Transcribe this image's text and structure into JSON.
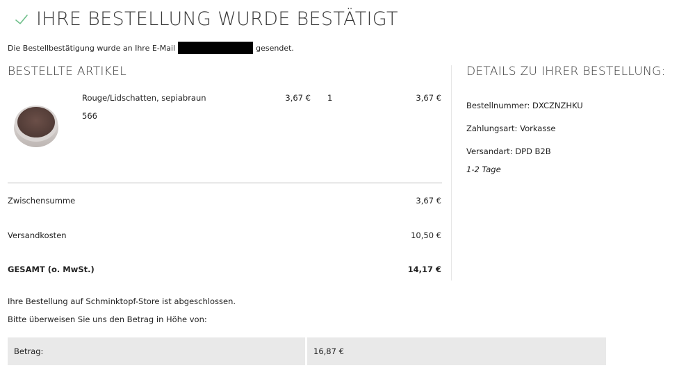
{
  "header": {
    "title": "IHRE BESTELLUNG WURDE BESTÄTIGT",
    "confirmation_prefix": "Die Bestellbestätigung wurde an Ihre E-Mail",
    "confirmation_suffix": "gesendet."
  },
  "ordered_items": {
    "title": "BESTELLTE ARTIKEL",
    "items": [
      {
        "name": "Rouge/Lidschatten, sepiabraun",
        "sku": "566",
        "unit_price": "3,67 €",
        "quantity": "1",
        "total": "3,67 €"
      }
    ]
  },
  "summary": {
    "subtotal_label": "Zwischensumme",
    "subtotal_value": "3,67 €",
    "shipping_label": "Versandkosten",
    "shipping_value": "10,50 €",
    "total_label": "GESAMT (o. MwSt.)",
    "total_value": "14,17 €"
  },
  "details": {
    "title": "DETAILS ZU IHRER BESTELLUNG:",
    "order_number": "Bestellnummer: DXCZNZHKU",
    "payment_method": "Zahlungsart: Vorkasse",
    "shipping_method": "Versandart: DPD B2B",
    "delivery_time": "1-2 Tage"
  },
  "footer": {
    "completed_text": "Ihre Bestellung auf Schminktopf-Store ist abgeschlossen.",
    "transfer_text": "Bitte überweisen Sie uns den Betrag in Höhe von:",
    "amount_label": "Betrag:",
    "amount_value": "16,87 €"
  },
  "colors": {
    "check": "#6fbf8a",
    "divider": "#bdbdbd",
    "payment_bg": "#e9e9e9"
  },
  "icons": {
    "check": "check-icon",
    "product": "product-thumbnail"
  }
}
